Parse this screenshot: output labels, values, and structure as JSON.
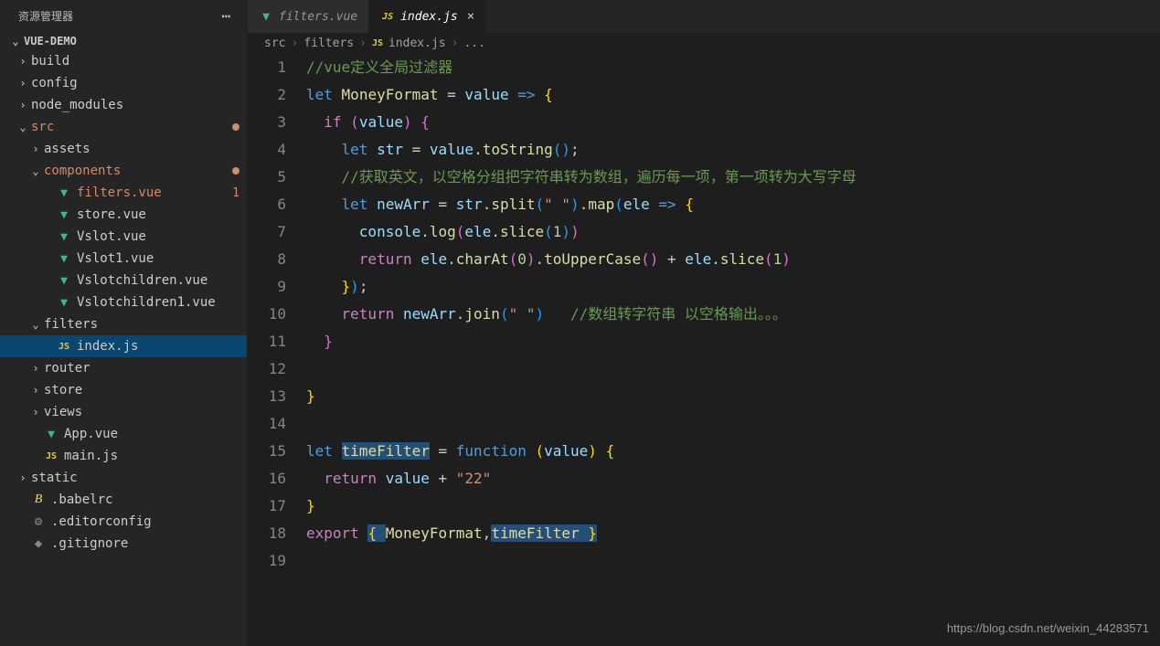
{
  "sidebar": {
    "title": "资源管理器",
    "project": "VUE-DEMO",
    "items": [
      {
        "label": "build",
        "type": "folder",
        "indent": 1,
        "chev": "›"
      },
      {
        "label": "config",
        "type": "folder",
        "indent": 1,
        "chev": "›"
      },
      {
        "label": "node_modules",
        "type": "folder",
        "indent": 1,
        "chev": "›"
      },
      {
        "label": "src",
        "type": "folder",
        "indent": 1,
        "chev": "⌄",
        "modified": true,
        "dot": true
      },
      {
        "label": "assets",
        "type": "folder",
        "indent": 2,
        "chev": "›"
      },
      {
        "label": "components",
        "type": "folder",
        "indent": 2,
        "chev": "⌄",
        "modified": true,
        "dot": true
      },
      {
        "label": "filters.vue",
        "type": "vue",
        "indent": 3,
        "modified": true,
        "badge": "1"
      },
      {
        "label": "store.vue",
        "type": "vue",
        "indent": 3
      },
      {
        "label": "Vslot.vue",
        "type": "vue",
        "indent": 3
      },
      {
        "label": "Vslot1.vue",
        "type": "vue",
        "indent": 3
      },
      {
        "label": "Vslotchildren.vue",
        "type": "vue",
        "indent": 3
      },
      {
        "label": "Vslotchildren1.vue",
        "type": "vue",
        "indent": 3
      },
      {
        "label": "filters",
        "type": "folder",
        "indent": 2,
        "chev": "⌄"
      },
      {
        "label": "index.js",
        "type": "js",
        "indent": 3,
        "selected": true
      },
      {
        "label": "router",
        "type": "folder",
        "indent": 2,
        "chev": "›"
      },
      {
        "label": "store",
        "type": "folder",
        "indent": 2,
        "chev": "›"
      },
      {
        "label": "views",
        "type": "folder",
        "indent": 2,
        "chev": "›"
      },
      {
        "label": "App.vue",
        "type": "vue",
        "indent": 2
      },
      {
        "label": "main.js",
        "type": "js",
        "indent": 2
      },
      {
        "label": "static",
        "type": "folder",
        "indent": 1,
        "chev": "›"
      },
      {
        "label": ".babelrc",
        "type": "babel",
        "indent": 1
      },
      {
        "label": ".editorconfig",
        "type": "gear",
        "indent": 1
      },
      {
        "label": ".gitignore",
        "type": "git",
        "indent": 1
      }
    ]
  },
  "tabs": [
    {
      "label": "filters.vue",
      "icon": "vue",
      "active": false
    },
    {
      "label": "index.js",
      "icon": "js",
      "active": true,
      "close": "×"
    }
  ],
  "breadcrumb": {
    "parts": [
      "src",
      "filters",
      "index.js",
      "..."
    ]
  },
  "code": {
    "lines": [
      {
        "n": 1,
        "tokens": [
          {
            "t": "//vue定义全局过滤器",
            "c": "c-comment"
          }
        ]
      },
      {
        "n": 2,
        "tokens": [
          {
            "t": "let",
            "c": "c-keyword"
          },
          {
            "t": " "
          },
          {
            "t": "MoneyFormat",
            "c": "c-func"
          },
          {
            "t": " = "
          },
          {
            "t": "value",
            "c": "c-var"
          },
          {
            "t": " "
          },
          {
            "t": "=>",
            "c": "c-keyword"
          },
          {
            "t": " "
          },
          {
            "t": "{",
            "c": "brace-y"
          }
        ]
      },
      {
        "n": 3,
        "tokens": [
          {
            "t": "  "
          },
          {
            "t": "if",
            "c": "c-control"
          },
          {
            "t": " "
          },
          {
            "t": "(",
            "c": "brace-p"
          },
          {
            "t": "value",
            "c": "c-var"
          },
          {
            "t": ")",
            "c": "brace-p"
          },
          {
            "t": " "
          },
          {
            "t": "{",
            "c": "brace-p"
          }
        ]
      },
      {
        "n": 4,
        "tokens": [
          {
            "t": "    "
          },
          {
            "t": "let",
            "c": "c-keyword"
          },
          {
            "t": " "
          },
          {
            "t": "str",
            "c": "c-var"
          },
          {
            "t": " = "
          },
          {
            "t": "value",
            "c": "c-var"
          },
          {
            "t": "."
          },
          {
            "t": "toString",
            "c": "c-func"
          },
          {
            "t": "(",
            "c": "brace-b"
          },
          {
            "t": ")",
            "c": "brace-b"
          },
          {
            "t": ";"
          }
        ]
      },
      {
        "n": 5,
        "tokens": [
          {
            "t": "    "
          },
          {
            "t": "//获取英文，以空格分组把字符串转为数组，遍历每一项，第一项转为大写字母",
            "c": "c-comment"
          }
        ]
      },
      {
        "n": 6,
        "tokens": [
          {
            "t": "    "
          },
          {
            "t": "let",
            "c": "c-keyword"
          },
          {
            "t": " "
          },
          {
            "t": "newArr",
            "c": "c-var"
          },
          {
            "t": " = "
          },
          {
            "t": "str",
            "c": "c-var"
          },
          {
            "t": "."
          },
          {
            "t": "split",
            "c": "c-func"
          },
          {
            "t": "(",
            "c": "brace-b"
          },
          {
            "t": "\" \"",
            "c": "c-string"
          },
          {
            "t": ")",
            "c": "brace-b"
          },
          {
            "t": "."
          },
          {
            "t": "map",
            "c": "c-func"
          },
          {
            "t": "(",
            "c": "brace-b"
          },
          {
            "t": "ele",
            "c": "c-var"
          },
          {
            "t": " "
          },
          {
            "t": "=>",
            "c": "c-keyword"
          },
          {
            "t": " "
          },
          {
            "t": "{",
            "c": "brace-y"
          }
        ]
      },
      {
        "n": 7,
        "tokens": [
          {
            "t": "      "
          },
          {
            "t": "console",
            "c": "c-var"
          },
          {
            "t": "."
          },
          {
            "t": "log",
            "c": "c-func"
          },
          {
            "t": "(",
            "c": "brace-p"
          },
          {
            "t": "ele",
            "c": "c-var"
          },
          {
            "t": "."
          },
          {
            "t": "slice",
            "c": "c-func"
          },
          {
            "t": "(",
            "c": "brace-b"
          },
          {
            "t": "1",
            "c": "c-number"
          },
          {
            "t": ")",
            "c": "brace-b"
          },
          {
            "t": ")",
            "c": "brace-p"
          }
        ]
      },
      {
        "n": 8,
        "tokens": [
          {
            "t": "      "
          },
          {
            "t": "return",
            "c": "c-control"
          },
          {
            "t": " "
          },
          {
            "t": "ele",
            "c": "c-var"
          },
          {
            "t": "."
          },
          {
            "t": "charAt",
            "c": "c-func"
          },
          {
            "t": "(",
            "c": "brace-p"
          },
          {
            "t": "0",
            "c": "c-number"
          },
          {
            "t": ")",
            "c": "brace-p"
          },
          {
            "t": "."
          },
          {
            "t": "toUpperCase",
            "c": "c-func"
          },
          {
            "t": "(",
            "c": "brace-p"
          },
          {
            "t": ")",
            "c": "brace-p"
          },
          {
            "t": " + "
          },
          {
            "t": "ele",
            "c": "c-var"
          },
          {
            "t": "."
          },
          {
            "t": "slice",
            "c": "c-func"
          },
          {
            "t": "(",
            "c": "brace-p"
          },
          {
            "t": "1",
            "c": "c-number"
          },
          {
            "t": ")",
            "c": "brace-p"
          }
        ]
      },
      {
        "n": 9,
        "tokens": [
          {
            "t": "    "
          },
          {
            "t": "}",
            "c": "brace-y"
          },
          {
            "t": ")",
            "c": "brace-b"
          },
          {
            "t": ";"
          }
        ]
      },
      {
        "n": 10,
        "tokens": [
          {
            "t": "    "
          },
          {
            "t": "return",
            "c": "c-control"
          },
          {
            "t": " "
          },
          {
            "t": "newArr",
            "c": "c-var"
          },
          {
            "t": "."
          },
          {
            "t": "join",
            "c": "c-func"
          },
          {
            "t": "(",
            "c": "brace-b"
          },
          {
            "t": "\" \"",
            "c": "c-string"
          },
          {
            "t": ")",
            "c": "brace-b"
          },
          {
            "t": "   "
          },
          {
            "t": "//数组转字符串 以空格输出。。。",
            "c": "c-comment"
          }
        ]
      },
      {
        "n": 11,
        "tokens": [
          {
            "t": "  "
          },
          {
            "t": "}",
            "c": "brace-p"
          }
        ]
      },
      {
        "n": 12,
        "tokens": []
      },
      {
        "n": 13,
        "tokens": [
          {
            "t": "}",
            "c": "brace-y"
          }
        ]
      },
      {
        "n": 14,
        "tokens": []
      },
      {
        "n": 15,
        "tokens": [
          {
            "t": "let",
            "c": "c-keyword"
          },
          {
            "t": " "
          },
          {
            "t": "timeFilter",
            "c": "c-func",
            "sel": true
          },
          {
            "t": " = "
          },
          {
            "t": "function",
            "c": "c-keyword"
          },
          {
            "t": " "
          },
          {
            "t": "(",
            "c": "brace-y"
          },
          {
            "t": "value",
            "c": "c-var"
          },
          {
            "t": ")",
            "c": "brace-y"
          },
          {
            "t": " "
          },
          {
            "t": "{",
            "c": "brace-y"
          }
        ]
      },
      {
        "n": 16,
        "tokens": [
          {
            "t": "  "
          },
          {
            "t": "return",
            "c": "c-control"
          },
          {
            "t": " "
          },
          {
            "t": "value",
            "c": "c-var"
          },
          {
            "t": " + "
          },
          {
            "t": "\"22\"",
            "c": "c-string"
          }
        ]
      },
      {
        "n": 17,
        "tokens": [
          {
            "t": "}",
            "c": "brace-y"
          }
        ]
      },
      {
        "n": 18,
        "tokens": [
          {
            "t": "export",
            "c": "c-control"
          },
          {
            "t": " "
          },
          {
            "t": "{ ",
            "c": "brace-y",
            "sel": true
          },
          {
            "t": "MoneyFormat",
            "c": "c-func"
          },
          {
            "t": ","
          },
          {
            "t": "timeFilter",
            "c": "c-func",
            "sel": true
          },
          {
            "t": " }",
            "c": "brace-y",
            "sel": true
          }
        ]
      },
      {
        "n": 19,
        "tokens": []
      }
    ]
  },
  "watermark": "https://blog.csdn.net/weixin_44283571"
}
